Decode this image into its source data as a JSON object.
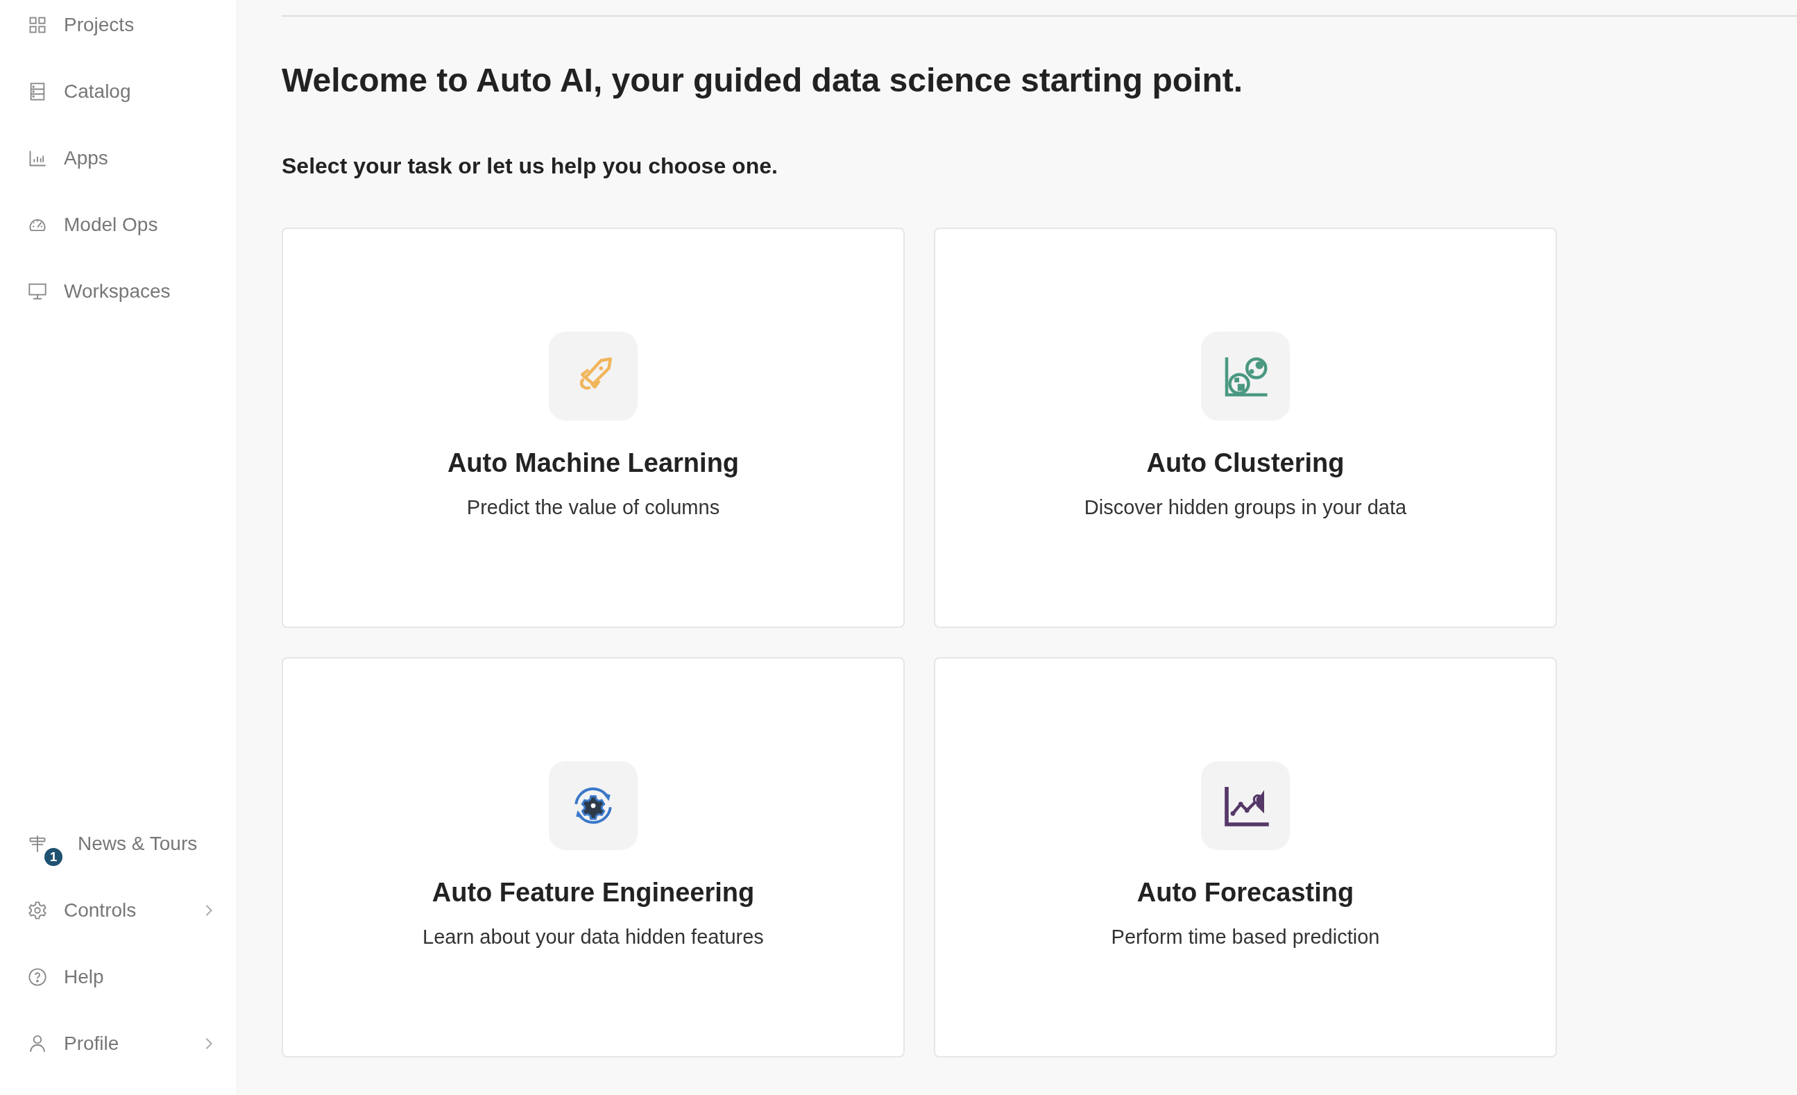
{
  "sidebar": {
    "top_items": [
      {
        "label": "Projects",
        "kind": "grid"
      },
      {
        "label": "Catalog",
        "kind": "cabinet"
      },
      {
        "label": "Apps",
        "kind": "bars"
      },
      {
        "label": "Model Ops",
        "kind": "gauge"
      },
      {
        "label": "Workspaces",
        "kind": "monitor"
      }
    ],
    "bottom_items": [
      {
        "label": "News & Tours",
        "kind": "signpost",
        "badge": "1",
        "expandable": false
      },
      {
        "label": "Controls",
        "kind": "gear",
        "expandable": true
      },
      {
        "label": "Help",
        "kind": "help",
        "expandable": false
      },
      {
        "label": "Profile",
        "kind": "person",
        "expandable": true
      }
    ]
  },
  "heading": "Welcome to Auto AI, your guided data science starting point.",
  "subheading": "Select your task or let us help you choose one.",
  "cards": [
    {
      "kind": "rocket",
      "title": "Auto Machine Learning",
      "description": "Predict the value of columns"
    },
    {
      "kind": "clusters",
      "title": "Auto Clustering",
      "description": "Discover hidden groups in your data"
    },
    {
      "kind": "features",
      "title": "Auto Feature Engineering",
      "description": "Learn about your data hidden features"
    },
    {
      "kind": "forecast",
      "title": "Auto Forecasting",
      "description": "Perform time based prediction"
    }
  ]
}
